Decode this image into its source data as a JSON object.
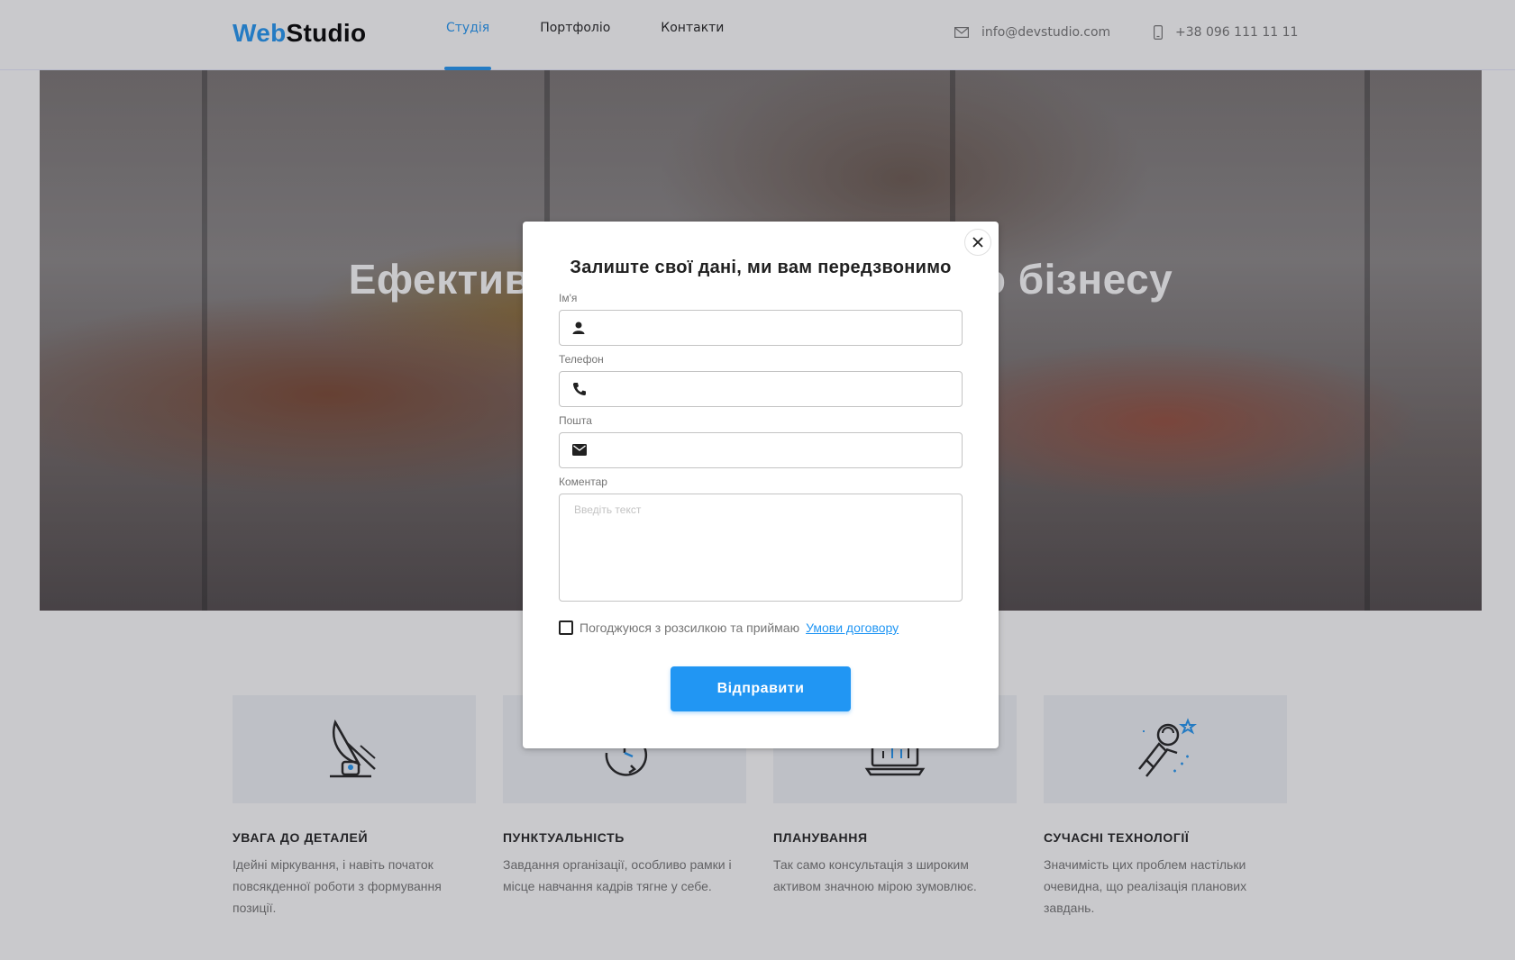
{
  "header": {
    "logo_part1": "Web",
    "logo_part2": "Studio",
    "nav": [
      {
        "label": "Студія",
        "active": true
      },
      {
        "label": "Портфоліо",
        "active": false
      },
      {
        "label": "Контакти",
        "active": false
      }
    ],
    "email": "info@devstudio.com",
    "phone": "+38 096 111 11 11",
    "email_icon": "mail-icon",
    "phone_icon": "smartphone-icon"
  },
  "hero": {
    "title": "Ефективні рішення для вашого бізнесу"
  },
  "features": [
    {
      "icon": "satellite-dish-icon",
      "title": "УВАГА ДО ДЕТАЛЕЙ",
      "text": "Ідейні міркування, і навіть початок повсякденної роботи з формування позиції."
    },
    {
      "icon": "clock-cycle-icon",
      "title": "ПУНКТУАЛЬНІСТЬ",
      "text": "Завдання організації, особливо рамки і місце навчання кадрів тягне у себе."
    },
    {
      "icon": "laptop-chart-icon",
      "title": "ПЛАНУВАННЯ",
      "text": "Так само консультація з широким активом значною мірою зумовлює."
    },
    {
      "icon": "astronaut-icon",
      "title": "СУЧАСНІ ТЕХНОЛОГІЇ",
      "text": "Значимість цих проблем настільки очевидна, що реалізація планових завдань."
    }
  ],
  "modal": {
    "title": "Залиште свої дані, ми вам передзвонимо",
    "close_icon": "close-icon",
    "fields": {
      "name": {
        "label": "Ім'я",
        "value": "",
        "icon": "person-icon"
      },
      "phone": {
        "label": "Телефон",
        "value": "",
        "icon": "phone-icon"
      },
      "email": {
        "label": "Пошта",
        "value": "",
        "icon": "envelope-icon"
      },
      "comment": {
        "label": "Коментар",
        "placeholder": "Введіть текст",
        "value": ""
      }
    },
    "agree_text": "Погоджуюся з розсилкою та приймаю",
    "agree_link": "Умови договору",
    "agree_checked": false,
    "submit_label": "Відправити"
  },
  "colors": {
    "accent": "#2196f3",
    "text": "#212121",
    "muted": "#757575"
  }
}
